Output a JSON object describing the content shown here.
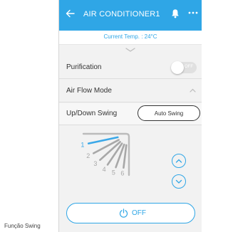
{
  "caption": "Função Swing",
  "header": {
    "title": "AIR CONDITIONER1",
    "back_icon": "back-arrow-icon",
    "bell_icon": "bell-icon",
    "more_icon": "more-dots-icon",
    "color": "#2fa6e6"
  },
  "status": {
    "current_temp": "Current Temp. : 24°C"
  },
  "purification": {
    "label": "Purification",
    "toggle_text": "OFF",
    "state": "off"
  },
  "air_flow": {
    "label": "Air Flow Mode",
    "expanded": true
  },
  "swing": {
    "label": "Up/Down Swing",
    "auto_label": "Auto Swing",
    "positions": [
      "1",
      "2",
      "3",
      "4",
      "5",
      "6"
    ],
    "selected_position": "1",
    "selected_color": "#3ba8e8",
    "inactive_color": "#a8a8a8"
  },
  "power": {
    "label": "OFF",
    "icon": "power-icon"
  }
}
